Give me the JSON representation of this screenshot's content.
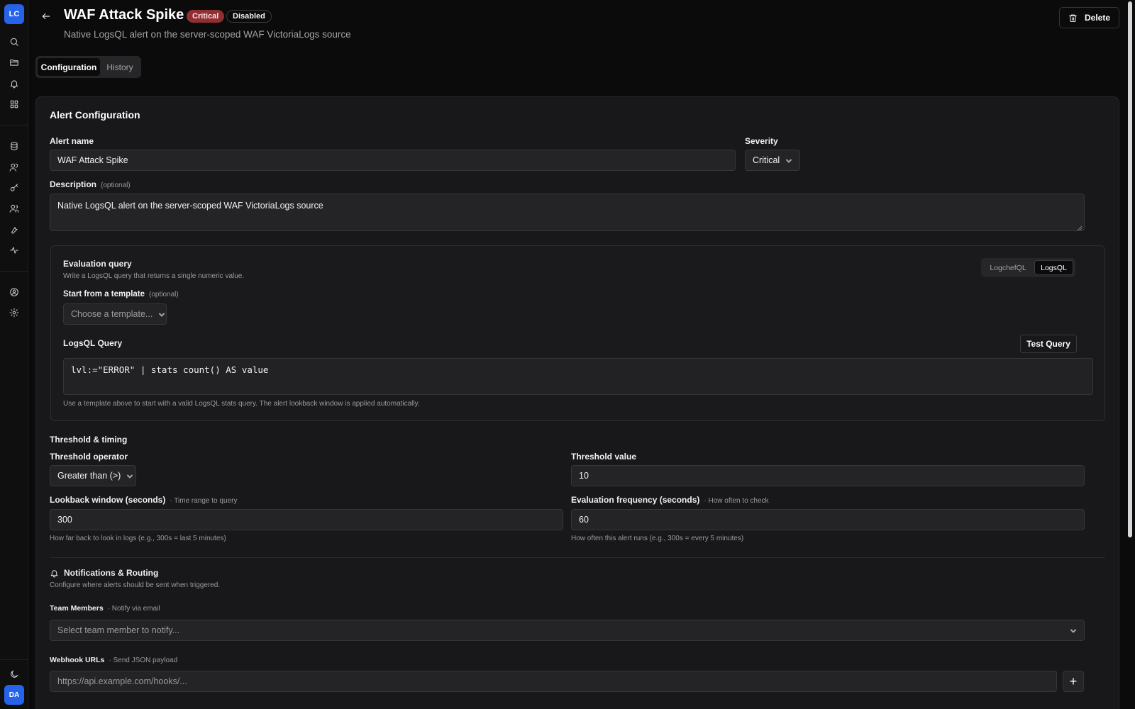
{
  "sidebar": {
    "logo_text": "LC",
    "avatar_text": "DA"
  },
  "header": {
    "title": "WAF Attack Spike",
    "severity_badge": "Critical",
    "status_badge": "Disabled",
    "subtitle": "Native LogsQL alert on the server-scoped WAF VictoriaLogs source",
    "delete_label": "Delete"
  },
  "tabs": [
    {
      "label": "Configuration",
      "active": true
    },
    {
      "label": "History",
      "active": false
    }
  ],
  "config": {
    "section_title": "Alert Configuration",
    "alert_name_label": "Alert name",
    "alert_name_value": "WAF Attack Spike",
    "severity_label": "Severity",
    "severity_value": "Critical",
    "description_label": "Description",
    "description_optional": "(optional)",
    "description_value": "Native LogsQL alert on the server-scoped WAF VictoriaLogs source"
  },
  "query": {
    "title": "Evaluation query",
    "subtitle": "Write a LogsQL query that returns a single numeric value.",
    "languages": [
      "LogchefQL",
      "LogsQL"
    ],
    "active_language": "LogsQL",
    "template_label": "Start from a template",
    "template_optional": "(optional)",
    "template_placeholder": "Choose a template...",
    "query_label": "LogsQL Query",
    "test_button": "Test Query",
    "query_value": "lvl:=\"ERROR\" | stats count() AS value",
    "help_text": "Use a template above to start with a valid LogsQL stats query. The alert lookback window is applied automatically."
  },
  "threshold": {
    "section_title": "Threshold & timing",
    "operator_label": "Threshold operator",
    "operator_value": "Greater than (>)",
    "value_label": "Threshold value",
    "value": "10",
    "lookback_label": "Lookback window (seconds)",
    "lookback_hint": "· Time range to query",
    "lookback_value": "300",
    "lookback_help": "How far back to look in logs (e.g., 300s = last 5 minutes)",
    "frequency_label": "Evaluation frequency (seconds)",
    "frequency_hint": "· How often to check",
    "frequency_value": "60",
    "frequency_help": "How often this alert runs (e.g., 300s = every 5 minutes)"
  },
  "notifications": {
    "title": "Notifications & Routing",
    "subtitle": "Configure where alerts should be sent when triggered.",
    "team_label": "Team Members",
    "team_hint": "· Notify via email",
    "team_placeholder": "Select team member to notify...",
    "webhook_label": "Webhook URLs",
    "webhook_hint": "· Send JSON payload",
    "webhook_placeholder": "https://api.example.com/hooks/...",
    "add_label": "+"
  },
  "colors": {
    "accent": "#2563eb",
    "critical": "#8f2f33",
    "background": "#0b0b0c",
    "card": "#18181a"
  }
}
